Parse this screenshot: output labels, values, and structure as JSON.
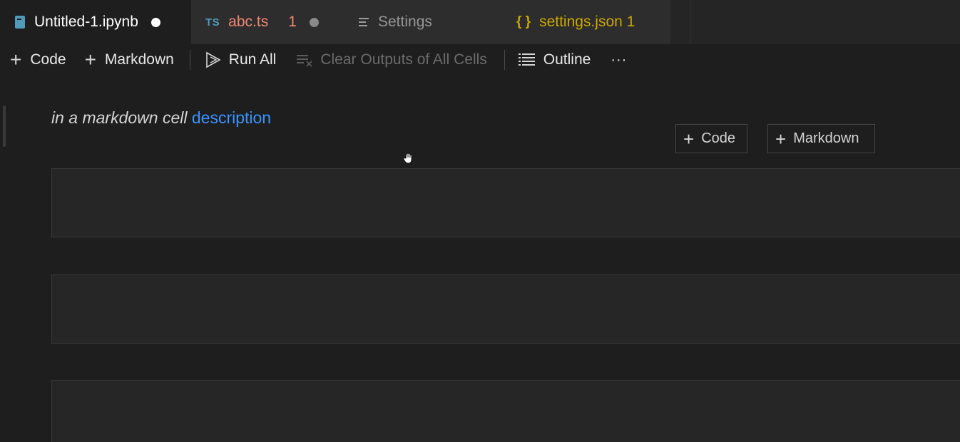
{
  "tabs": [
    {
      "label": "Untitled-1.ipynb",
      "icon": "notebook-icon",
      "color": "#ffffff",
      "modified": true,
      "active": true
    },
    {
      "badge": "TS",
      "label": "abc.ts",
      "problems": "1",
      "color": "#f48771",
      "modified": true
    },
    {
      "label": "Settings",
      "icon": "settings-file-icon",
      "color": "#969696"
    },
    {
      "label": "settings.json 1",
      "icon": "json-braces-icon",
      "color": "#cca700"
    }
  ],
  "toolbar": {
    "add_code_label": "Code",
    "add_markdown_label": "Markdown",
    "run_all_label": "Run All",
    "clear_outputs_label": "Clear Outputs of All Cells",
    "outline_label": "Outline",
    "more_label": "···"
  },
  "markdown_cell": {
    "italic_text": "in a markdown cell",
    "link_text": "description"
  },
  "insert_toolbar": {
    "code_label": "Code",
    "markdown_label": "Markdown"
  },
  "colors": {
    "accent_link": "#3794ff",
    "background": "#1e1e1e",
    "json_yellow": "#cca700",
    "ts_blue": "#519aba",
    "error_red": "#f48771"
  }
}
